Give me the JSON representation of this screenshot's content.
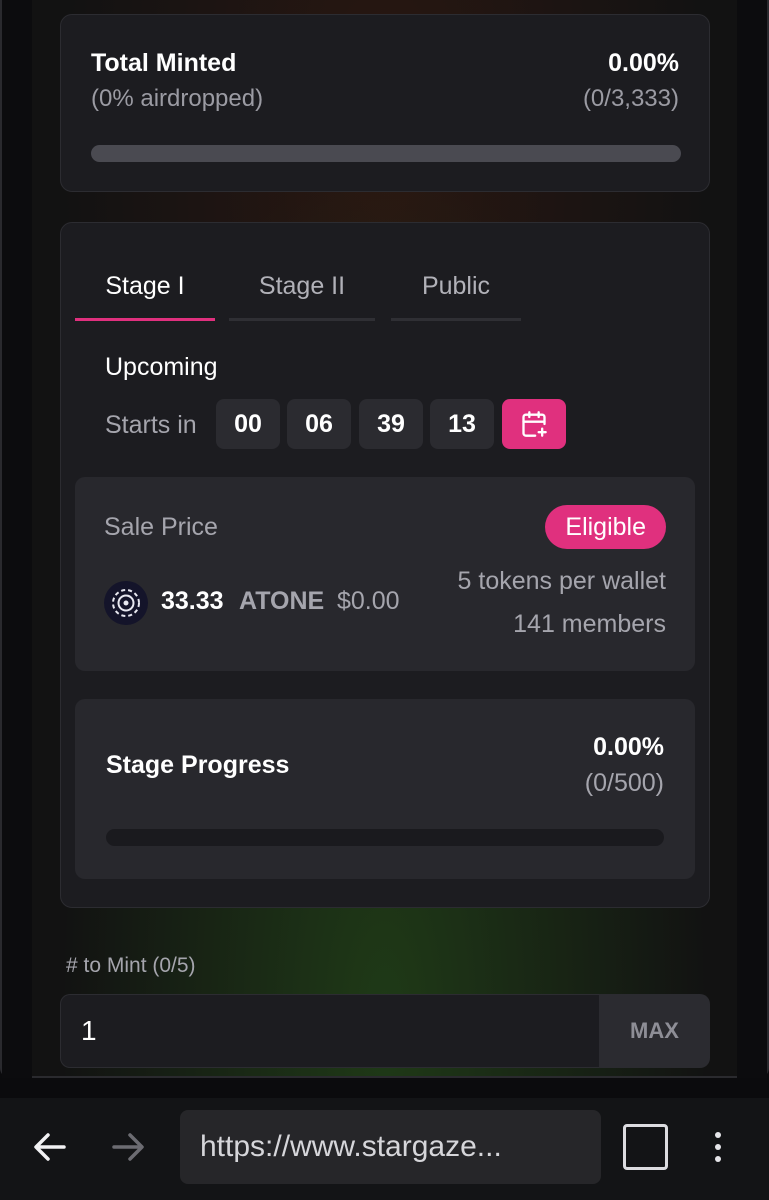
{
  "total_minted": {
    "title": "Total Minted",
    "airdropped": "(0% airdropped)",
    "percent": "0.00%",
    "count": "(0/3,333)",
    "progress": 0
  },
  "stages": {
    "tabs": [
      {
        "label": "Stage I",
        "active": true
      },
      {
        "label": "Stage II",
        "active": false
      },
      {
        "label": "Public",
        "active": false
      }
    ],
    "status": "Upcoming",
    "starts_label": "Starts in",
    "countdown": [
      "00",
      "06",
      "39",
      "13"
    ],
    "calendar_icon": "calendar-plus-icon"
  },
  "sale": {
    "label": "Sale Price",
    "badge": "Eligible",
    "price": "33.33",
    "currency": "ATONE",
    "usd": "$0.00",
    "tokens_per_wallet": "5 tokens per wallet",
    "members": "141 members",
    "coin_icon": "atone-coin-icon"
  },
  "stage_progress": {
    "title": "Stage Progress",
    "percent": "0.00%",
    "count": "(0/500)",
    "progress": 0
  },
  "mint": {
    "label": "# to Mint (0/5)",
    "value": "1",
    "max_label": "MAX"
  },
  "browser": {
    "url": "https://www.stargaze..."
  },
  "colors": {
    "accent": "#e0307e",
    "card": "#1c1c20",
    "inner": "#28282d"
  }
}
